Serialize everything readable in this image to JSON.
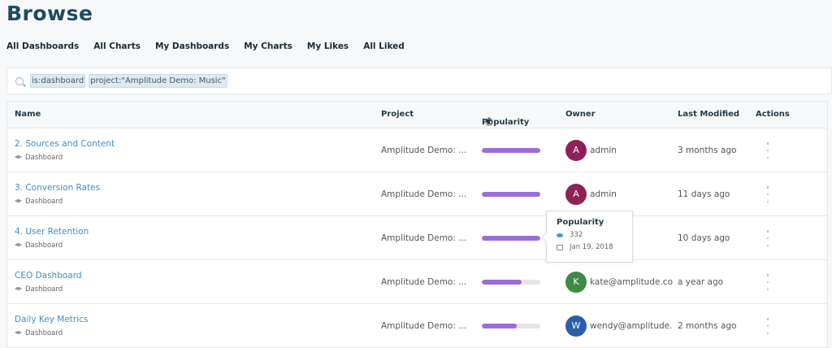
{
  "title": "Browse",
  "tabs": [
    "All Dashboards",
    "All Charts",
    "My Dashboards",
    "My Charts",
    "My Likes",
    "All Liked"
  ],
  "search": {
    "chips": [
      "is:dashboard",
      "project:\"Amplitude Demo: Music\""
    ]
  },
  "columns": {
    "name": "Name",
    "project": "Project",
    "popularity": "Popularity",
    "owner": "Owner",
    "modified": "Last Modified",
    "actions": "Actions"
  },
  "colors": {
    "accent": "#9b6ddb",
    "link": "#3b8ec7"
  },
  "rows": [
    {
      "name": "2. Sources and Content",
      "type": "Dashboard",
      "project": "Amplitude Demo: ...",
      "popularity": 1.0,
      "initial": "A",
      "avatar_color": "#8e2158",
      "owner": "admin",
      "modified": "3 months ago"
    },
    {
      "name": "3. Conversion Rates",
      "type": "Dashboard",
      "project": "Amplitude Demo: ...",
      "popularity": 1.0,
      "initial": "A",
      "avatar_color": "#8e2158",
      "owner": "admin",
      "modified": "11 days ago"
    },
    {
      "name": "4. User Retention",
      "type": "Dashboard",
      "project": "Amplitude Demo: ...",
      "popularity": 1.0,
      "initial": "",
      "avatar_color": "",
      "owner": "",
      "modified": "10 days ago"
    },
    {
      "name": "CEO Dashboard",
      "type": "Dashboard",
      "project": "Amplitude Demo: ...",
      "popularity": 0.68,
      "initial": "K",
      "avatar_color": "#3f8a44",
      "owner": "kate@amplitude.com",
      "modified": "a year ago"
    },
    {
      "name": "Daily Key Metrics",
      "type": "Dashboard",
      "project": "Amplitude Demo: ...",
      "popularity": 0.6,
      "initial": "W",
      "avatar_color": "#2a5ea8",
      "owner": "wendy@amplitude.com",
      "modified": "2 months ago"
    }
  ],
  "tooltip": {
    "title": "Popularity",
    "views": "332",
    "date": "Jan 19, 2018"
  }
}
